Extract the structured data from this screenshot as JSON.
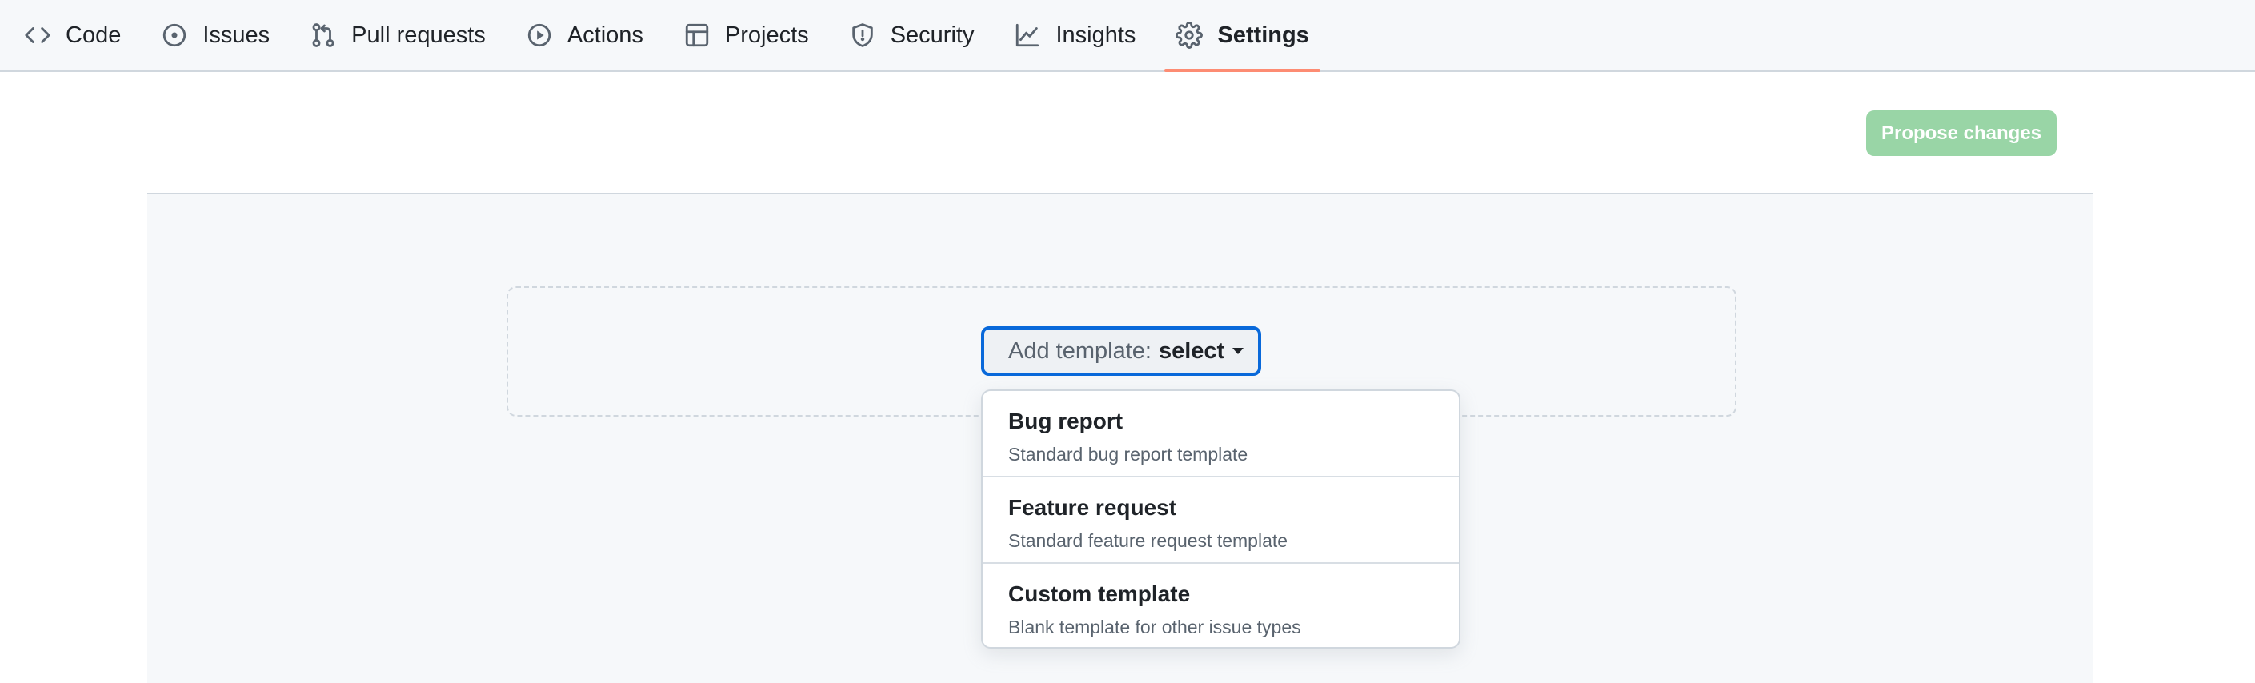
{
  "nav": {
    "items": [
      {
        "label": "Code",
        "icon": "code-icon"
      },
      {
        "label": "Issues",
        "icon": "issue-opened-icon"
      },
      {
        "label": "Pull requests",
        "icon": "git-pull-request-icon"
      },
      {
        "label": "Actions",
        "icon": "play-icon"
      },
      {
        "label": "Projects",
        "icon": "table-icon"
      },
      {
        "label": "Security",
        "icon": "shield-icon"
      },
      {
        "label": "Insights",
        "icon": "graph-icon"
      },
      {
        "label": "Settings",
        "icon": "gear-icon",
        "selected": true
      }
    ]
  },
  "actions": {
    "propose_label": "Propose changes"
  },
  "template_selector": {
    "prefix": "Add template:",
    "value": "select"
  },
  "menu": {
    "items": [
      {
        "title": "Bug report",
        "description": "Standard bug report template"
      },
      {
        "title": "Feature request",
        "description": "Standard feature request template"
      },
      {
        "title": "Custom template",
        "description": "Blank template for other issue types"
      }
    ]
  },
  "colors": {
    "accent": "#0969da",
    "selected_underline": "#fd8c73",
    "propose_button": "#94d3a2"
  }
}
